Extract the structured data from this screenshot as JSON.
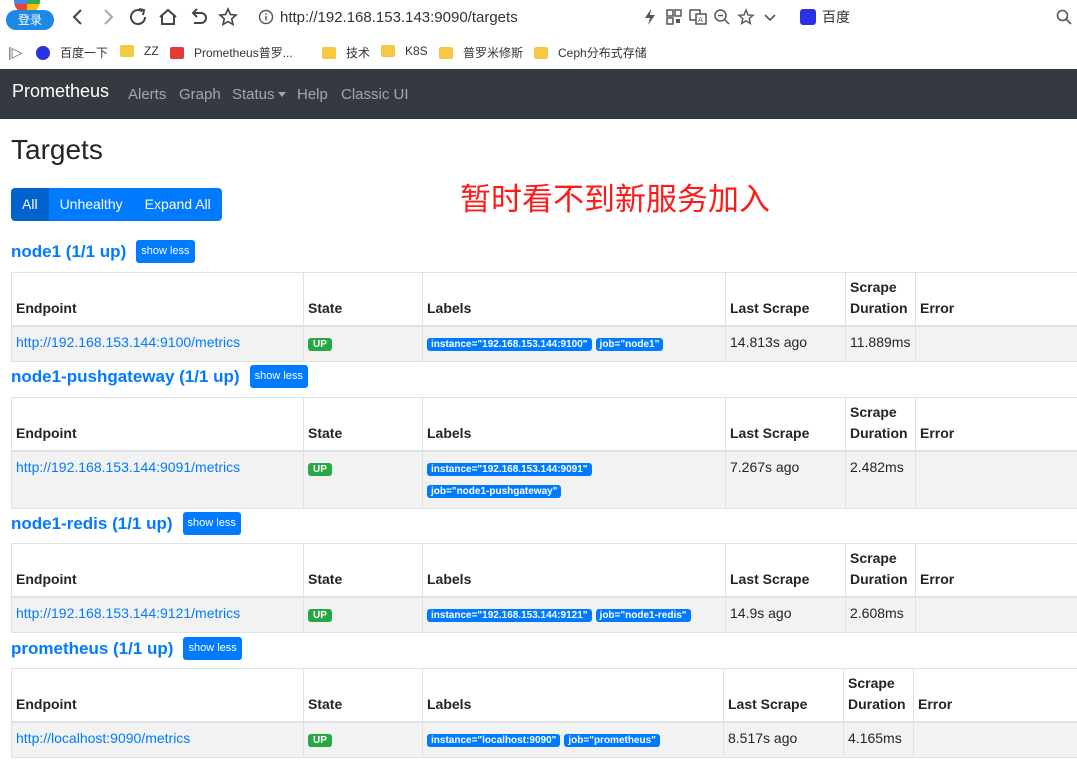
{
  "browser": {
    "login_label": "登录",
    "url": "http://192.168.153.143:9090/targets",
    "search_engine": "百度",
    "bookmarks": [
      {
        "label": "百度一下",
        "icon": "baidu-paw-icon"
      },
      {
        "label": "ZZ",
        "icon": "folder-icon"
      },
      {
        "label": "Prometheus普罗...",
        "icon": "bookmark-red-icon"
      },
      {
        "label": "技术",
        "icon": "folder-icon"
      },
      {
        "label": "K8S",
        "icon": "folder-icon"
      },
      {
        "label": "普罗米修斯",
        "icon": "folder-icon"
      },
      {
        "label": "Ceph分布式存储",
        "icon": "folder-icon"
      }
    ]
  },
  "navbar": {
    "brand": "Prometheus",
    "links": [
      "Alerts",
      "Graph",
      "Status",
      "Help",
      "Classic UI"
    ]
  },
  "page": {
    "title": "Targets",
    "filters": [
      "All",
      "Unhealthy",
      "Expand All"
    ],
    "annotation": "暂时看不到新服务加入"
  },
  "table_headers": {
    "endpoint": "Endpoint",
    "state": "State",
    "labels": "Labels",
    "last_scrape": "Last Scrape",
    "scrape_duration_1": "Scrape",
    "scrape_duration_2": "Duration",
    "error": "Error"
  },
  "jobs": [
    {
      "title": "node1 (1/1 up)",
      "toggle": "show less",
      "endpoint": "http://192.168.153.144:9100/metrics",
      "state": "UP",
      "labels": [
        "instance=\"192.168.153.144:9100\"",
        "job=\"node1\""
      ],
      "last_scrape": "14.813s ago",
      "duration": "11.889ms",
      "error": ""
    },
    {
      "title": "node1-pushgateway (1/1 up)",
      "toggle": "show less",
      "endpoint": "http://192.168.153.144:9091/metrics",
      "state": "UP",
      "labels": [
        "instance=\"192.168.153.144:9091\"",
        "job=\"node1-pushgateway\""
      ],
      "last_scrape": "7.267s ago",
      "duration": "2.482ms",
      "error": ""
    },
    {
      "title": "node1-redis (1/1 up)",
      "toggle": "show less",
      "endpoint": "http://192.168.153.144:9121/metrics",
      "state": "UP",
      "labels": [
        "instance=\"192.168.153.144:9121\"",
        "job=\"node1-redis\""
      ],
      "last_scrape": "14.9s ago",
      "duration": "2.608ms",
      "error": ""
    },
    {
      "title": "prometheus (1/1 up)",
      "toggle": "show less",
      "endpoint": "http://localhost:9090/metrics",
      "state": "UP",
      "labels": [
        "instance=\"localhost:9090\"",
        "job=\"prometheus\""
      ],
      "last_scrape": "8.517s ago",
      "duration": "4.165ms",
      "error": ""
    }
  ]
}
